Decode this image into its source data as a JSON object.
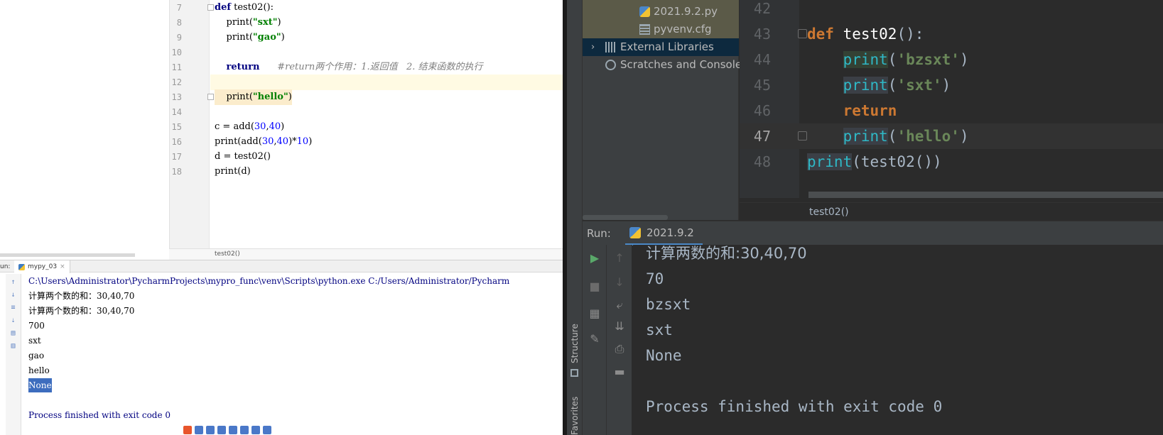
{
  "left_editor": {
    "lines": [
      {
        "num": "7",
        "text": "def test02():"
      },
      {
        "num": "8",
        "text": "    print(\"sxt\")"
      },
      {
        "num": "9",
        "text": "    print(\"gao\")"
      },
      {
        "num": "10",
        "text": ""
      },
      {
        "num": "11",
        "text": "    return      #return两个作用：1.返回值   2. 结束函数的执行"
      },
      {
        "num": "12",
        "text": ""
      },
      {
        "num": "13",
        "text": "    print(\"hello\")"
      },
      {
        "num": "14",
        "text": ""
      },
      {
        "num": "15",
        "text": "c = add(30,40)"
      },
      {
        "num": "16",
        "text": "print(add(30,40)*10)"
      },
      {
        "num": "17",
        "text": "d = test02()"
      },
      {
        "num": "18",
        "text": "print(d)"
      }
    ],
    "breadcrumb": "test02()"
  },
  "left_run": {
    "label": "un:",
    "tab": "mypy_03",
    "console_lines": [
      "C:\\Users\\Administrator\\PycharmProjects\\mypro_func\\venv\\Scripts\\python.exe C:/Users/Administrator/Pycharm",
      "计算两个数的和：30,40,70",
      "计算两个数的和：30,40,70",
      "700",
      "sxt",
      "gao",
      "hello",
      "None",
      "",
      "Process finished with exit code 0"
    ]
  },
  "right_project": {
    "items": [
      {
        "label": "2021.9.2.py",
        "icon": "python-file-icon"
      },
      {
        "label": "pyvenv.cfg",
        "icon": "config-file-icon"
      },
      {
        "label": "External Libraries",
        "icon": "library-icon"
      },
      {
        "label": "Scratches and Consoles",
        "icon": "scratches-icon"
      }
    ]
  },
  "right_editor": {
    "lines": [
      {
        "num": "42"
      },
      {
        "num": "43"
      },
      {
        "num": "44"
      },
      {
        "num": "45"
      },
      {
        "num": "46"
      },
      {
        "num": "47"
      },
      {
        "num": "48"
      }
    ],
    "breadcrumb": "test02()"
  },
  "right_run": {
    "label": "Run:",
    "tab": "2021.9.2",
    "console_lines": [
      "计算两数的和:30,40,70",
      "70",
      "bzsxt",
      "sxt",
      "None",
      "",
      "Process finished with exit code 0"
    ]
  },
  "side_tabs": {
    "structure": "Structure",
    "favorites": "Favorites"
  },
  "colors": {
    "dark_bg": "#2b2b2b",
    "keyword": "#cc7832",
    "string": "#6a8759",
    "builtin": "#2fb8c6",
    "selection": "#3d6dbe"
  }
}
